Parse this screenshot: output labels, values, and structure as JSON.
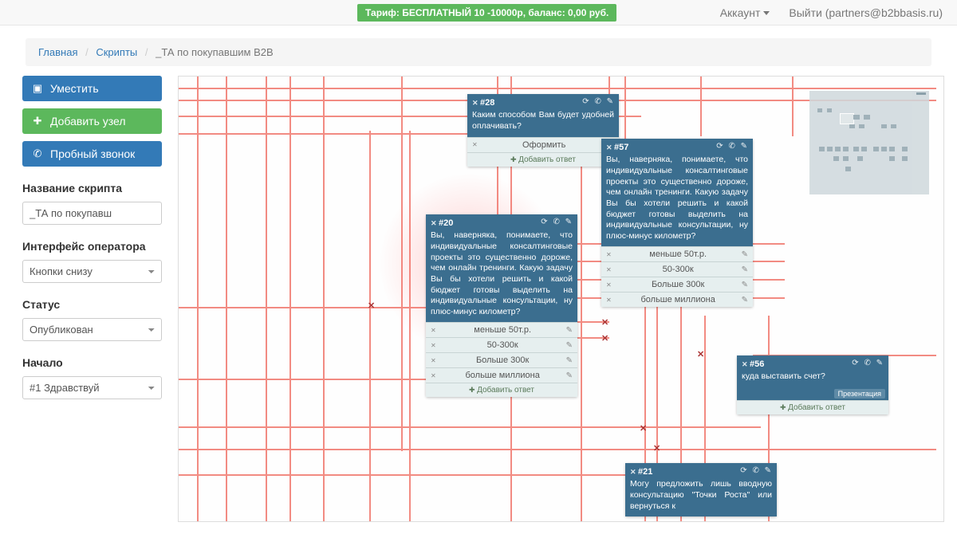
{
  "topbar": {
    "tariff": "Тариф: БЕСПЛАТНЫЙ 10 -10000р, баланс: 0,00 руб.",
    "account": "Аккаунт",
    "logout": "Выйти (partners@b2bbasis.ru)"
  },
  "breadcrumb": {
    "home": "Главная",
    "scripts": "Скрипты",
    "current": "_ТА по покупавшим B2B"
  },
  "sidebar": {
    "fit": "Уместить",
    "add_node": "Добавить узел",
    "test_call": "Пробный звонок",
    "script_name_label": "Название скрипта",
    "script_name_value": "_ТА по покупавш",
    "operator_iface_label": "Интерфейс оператора",
    "operator_iface_value": "Кнопки снизу",
    "status_label": "Статус",
    "status_value": "Опубликован",
    "start_label": "Начало",
    "start_value": "#1 Здравствуй"
  },
  "nodes": {
    "n28": {
      "id": "#28",
      "text": "Каким способом Вам будет удобней оплачивать?",
      "answers": [
        "Оформить"
      ],
      "add": "Добавить ответ"
    },
    "n20": {
      "id": "#20",
      "text": "Вы, наверняка, понимаете, что индивидуальные консалтинговые проекты это существенно дороже, чем онлайн тренинги.&nbsp;Какую задачу Вы бы хотели решить и какой бюджет готовы выделить на индивидуальные консультации, ну плюс-минус километр?",
      "answers": [
        "меньше 50т.р.",
        "50-300к",
        "Больше 300к",
        "больше миллиона"
      ],
      "add": "Добавить ответ"
    },
    "n57": {
      "id": "#57",
      "text": "Вы, наверняка, понимаете, что индивидуальные консалтинговые проекты это существенно дороже, чем онлайн тренинги.&nbsp;Какую задачу Вы бы хотели решить и какой бюджет готовы выделить на индивидуальные консультации, ну плюс-минус километр?",
      "answers": [
        "меньше 50т.р.",
        "50-300к",
        "Больше 300к",
        "больше миллиона"
      ]
    },
    "n56": {
      "id": "#56",
      "text": "куда выставить счет?",
      "badge": "Презентация",
      "add": "Добавить ответ"
    },
    "n21": {
      "id": "#21",
      "text": "Могу предложить лишь вводную консультацию \"Точки Роста\"&nbsp;или вернуться к"
    }
  }
}
